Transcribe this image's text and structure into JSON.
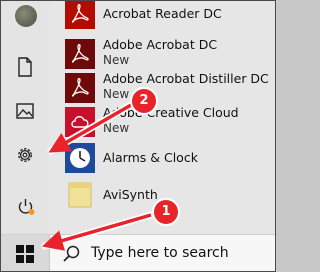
{
  "apps": [
    {
      "name": "Acrobat Reader DC",
      "sub": "",
      "icon": "acrobat-reader-icon"
    },
    {
      "name": "Adobe Acrobat DC",
      "sub": "New",
      "icon": "adobe-acrobat-icon"
    },
    {
      "name": "Adobe Acrobat Distiller DC",
      "sub": "New",
      "icon": "acrobat-distiller-icon"
    },
    {
      "name": "Adobe Creative Cloud",
      "sub": "New",
      "icon": "creative-cloud-icon"
    },
    {
      "name": "Alarms & Clock",
      "sub": "",
      "icon": "clock-icon"
    },
    {
      "name": "AviSynth",
      "sub": "",
      "icon": "folder-icon"
    }
  ],
  "rail": [
    "user-avatar",
    "documents-icon",
    "pictures-icon",
    "settings-gear-icon",
    "power-icon"
  ],
  "taskbar": {
    "search_placeholder": "Type here to search"
  },
  "callouts": [
    "1",
    "2"
  ],
  "colors": {
    "adobe_red": "#b30b00",
    "creative_cloud": "#c8102e",
    "callout_red": "#e8232a",
    "clock_blue": "#1f4a9c",
    "folder_yellow": "#f2e199"
  }
}
